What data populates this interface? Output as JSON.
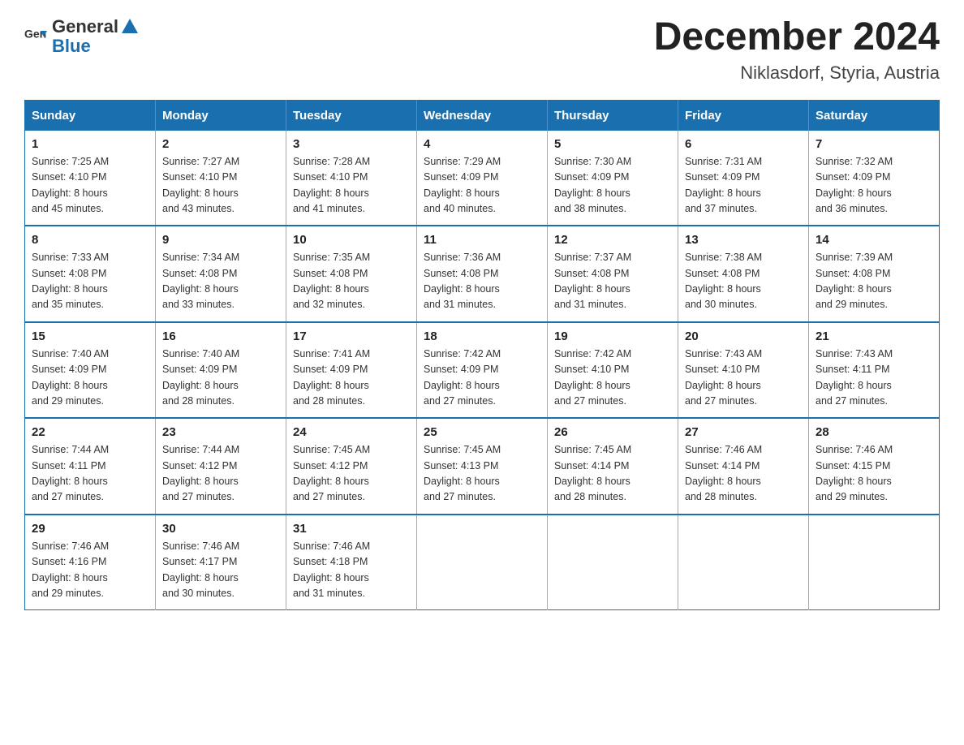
{
  "header": {
    "logo_general": "General",
    "logo_blue": "Blue",
    "month_year": "December 2024",
    "location": "Niklasdorf, Styria, Austria"
  },
  "weekdays": [
    "Sunday",
    "Monday",
    "Tuesday",
    "Wednesday",
    "Thursday",
    "Friday",
    "Saturday"
  ],
  "weeks": [
    [
      {
        "day": "1",
        "sunrise": "7:25 AM",
        "sunset": "4:10 PM",
        "daylight": "8 hours and 45 minutes."
      },
      {
        "day": "2",
        "sunrise": "7:27 AM",
        "sunset": "4:10 PM",
        "daylight": "8 hours and 43 minutes."
      },
      {
        "day": "3",
        "sunrise": "7:28 AM",
        "sunset": "4:10 PM",
        "daylight": "8 hours and 41 minutes."
      },
      {
        "day": "4",
        "sunrise": "7:29 AM",
        "sunset": "4:09 PM",
        "daylight": "8 hours and 40 minutes."
      },
      {
        "day": "5",
        "sunrise": "7:30 AM",
        "sunset": "4:09 PM",
        "daylight": "8 hours and 38 minutes."
      },
      {
        "day": "6",
        "sunrise": "7:31 AM",
        "sunset": "4:09 PM",
        "daylight": "8 hours and 37 minutes."
      },
      {
        "day": "7",
        "sunrise": "7:32 AM",
        "sunset": "4:09 PM",
        "daylight": "8 hours and 36 minutes."
      }
    ],
    [
      {
        "day": "8",
        "sunrise": "7:33 AM",
        "sunset": "4:08 PM",
        "daylight": "8 hours and 35 minutes."
      },
      {
        "day": "9",
        "sunrise": "7:34 AM",
        "sunset": "4:08 PM",
        "daylight": "8 hours and 33 minutes."
      },
      {
        "day": "10",
        "sunrise": "7:35 AM",
        "sunset": "4:08 PM",
        "daylight": "8 hours and 32 minutes."
      },
      {
        "day": "11",
        "sunrise": "7:36 AM",
        "sunset": "4:08 PM",
        "daylight": "8 hours and 31 minutes."
      },
      {
        "day": "12",
        "sunrise": "7:37 AM",
        "sunset": "4:08 PM",
        "daylight": "8 hours and 31 minutes."
      },
      {
        "day": "13",
        "sunrise": "7:38 AM",
        "sunset": "4:08 PM",
        "daylight": "8 hours and 30 minutes."
      },
      {
        "day": "14",
        "sunrise": "7:39 AM",
        "sunset": "4:08 PM",
        "daylight": "8 hours and 29 minutes."
      }
    ],
    [
      {
        "day": "15",
        "sunrise": "7:40 AM",
        "sunset": "4:09 PM",
        "daylight": "8 hours and 29 minutes."
      },
      {
        "day": "16",
        "sunrise": "7:40 AM",
        "sunset": "4:09 PM",
        "daylight": "8 hours and 28 minutes."
      },
      {
        "day": "17",
        "sunrise": "7:41 AM",
        "sunset": "4:09 PM",
        "daylight": "8 hours and 28 minutes."
      },
      {
        "day": "18",
        "sunrise": "7:42 AM",
        "sunset": "4:09 PM",
        "daylight": "8 hours and 27 minutes."
      },
      {
        "day": "19",
        "sunrise": "7:42 AM",
        "sunset": "4:10 PM",
        "daylight": "8 hours and 27 minutes."
      },
      {
        "day": "20",
        "sunrise": "7:43 AM",
        "sunset": "4:10 PM",
        "daylight": "8 hours and 27 minutes."
      },
      {
        "day": "21",
        "sunrise": "7:43 AM",
        "sunset": "4:11 PM",
        "daylight": "8 hours and 27 minutes."
      }
    ],
    [
      {
        "day": "22",
        "sunrise": "7:44 AM",
        "sunset": "4:11 PM",
        "daylight": "8 hours and 27 minutes."
      },
      {
        "day": "23",
        "sunrise": "7:44 AM",
        "sunset": "4:12 PM",
        "daylight": "8 hours and 27 minutes."
      },
      {
        "day": "24",
        "sunrise": "7:45 AM",
        "sunset": "4:12 PM",
        "daylight": "8 hours and 27 minutes."
      },
      {
        "day": "25",
        "sunrise": "7:45 AM",
        "sunset": "4:13 PM",
        "daylight": "8 hours and 27 minutes."
      },
      {
        "day": "26",
        "sunrise": "7:45 AM",
        "sunset": "4:14 PM",
        "daylight": "8 hours and 28 minutes."
      },
      {
        "day": "27",
        "sunrise": "7:46 AM",
        "sunset": "4:14 PM",
        "daylight": "8 hours and 28 minutes."
      },
      {
        "day": "28",
        "sunrise": "7:46 AM",
        "sunset": "4:15 PM",
        "daylight": "8 hours and 29 minutes."
      }
    ],
    [
      {
        "day": "29",
        "sunrise": "7:46 AM",
        "sunset": "4:16 PM",
        "daylight": "8 hours and 29 minutes."
      },
      {
        "day": "30",
        "sunrise": "7:46 AM",
        "sunset": "4:17 PM",
        "daylight": "8 hours and 30 minutes."
      },
      {
        "day": "31",
        "sunrise": "7:46 AM",
        "sunset": "4:18 PM",
        "daylight": "8 hours and 31 minutes."
      },
      null,
      null,
      null,
      null
    ]
  ],
  "labels": {
    "sunrise": "Sunrise:",
    "sunset": "Sunset:",
    "daylight": "Daylight:"
  }
}
